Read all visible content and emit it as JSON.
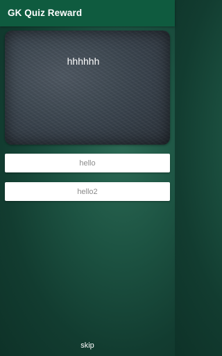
{
  "app_bar": {
    "title": "GK Quiz Reward"
  },
  "question": {
    "text": "hhhhhh"
  },
  "answers": [
    {
      "label": "hello"
    },
    {
      "label": "hello2"
    }
  ],
  "footer": {
    "skip_label": "skip"
  },
  "colors": {
    "app_bar": "#0f5b3f",
    "background": "#1d5443",
    "card": "#3c4650",
    "answer_background": "#ffffff",
    "answer_text": "#8a8a8a"
  }
}
